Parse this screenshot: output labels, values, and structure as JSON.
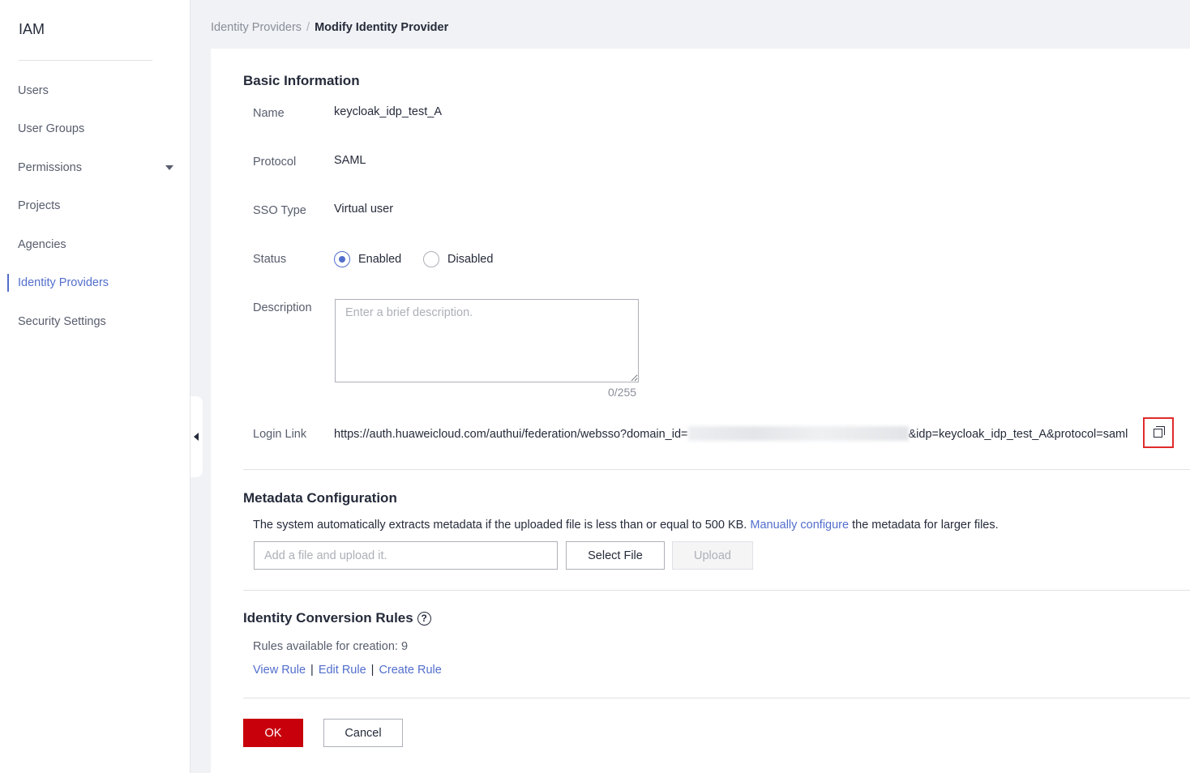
{
  "sidebar": {
    "title": "IAM",
    "items": [
      {
        "label": "Users"
      },
      {
        "label": "User Groups"
      },
      {
        "label": "Permissions"
      },
      {
        "label": "Projects"
      },
      {
        "label": "Agencies"
      },
      {
        "label": "Identity Providers"
      },
      {
        "label": "Security Settings"
      }
    ]
  },
  "breadcrumb": {
    "parent": "Identity Providers",
    "separator": "/",
    "current": "Modify Identity Provider"
  },
  "basic_info": {
    "title": "Basic Information",
    "name_label": "Name",
    "name_value": "keycloak_idp_test_A",
    "protocol_label": "Protocol",
    "protocol_value": "SAML",
    "sso_type_label": "SSO Type",
    "sso_type_value": "Virtual user",
    "status_label": "Status",
    "status_enabled": "Enabled",
    "status_disabled": "Disabled",
    "description_label": "Description",
    "description_placeholder": "Enter a brief description.",
    "description_counter": "0/255",
    "login_link_label": "Login Link",
    "login_link_prefix": "https://auth.huaweicloud.com/authui/federation/websso?domain_id=",
    "login_link_suffix": "&idp=keycloak_idp_test_A&protocol=saml"
  },
  "metadata": {
    "title": "Metadata Configuration",
    "desc_before": "The system automatically extracts metadata if the uploaded file is less than or equal to 500 KB. ",
    "desc_link": "Manually configure",
    "desc_after": " the metadata for larger files.",
    "file_placeholder": "Add a file and upload it.",
    "select_file": "Select File",
    "upload": "Upload"
  },
  "rules": {
    "title": "Identity Conversion Rules",
    "help_glyph": "?",
    "available": "Rules available for creation: 9",
    "view": "View Rule",
    "edit": "Edit Rule",
    "create": "Create Rule",
    "divider": "|"
  },
  "footer": {
    "ok": "OK",
    "cancel": "Cancel"
  },
  "colors": {
    "accent": "#526ecc",
    "primary_button": "#c7000b",
    "highlight_border": "#e02b2b"
  }
}
